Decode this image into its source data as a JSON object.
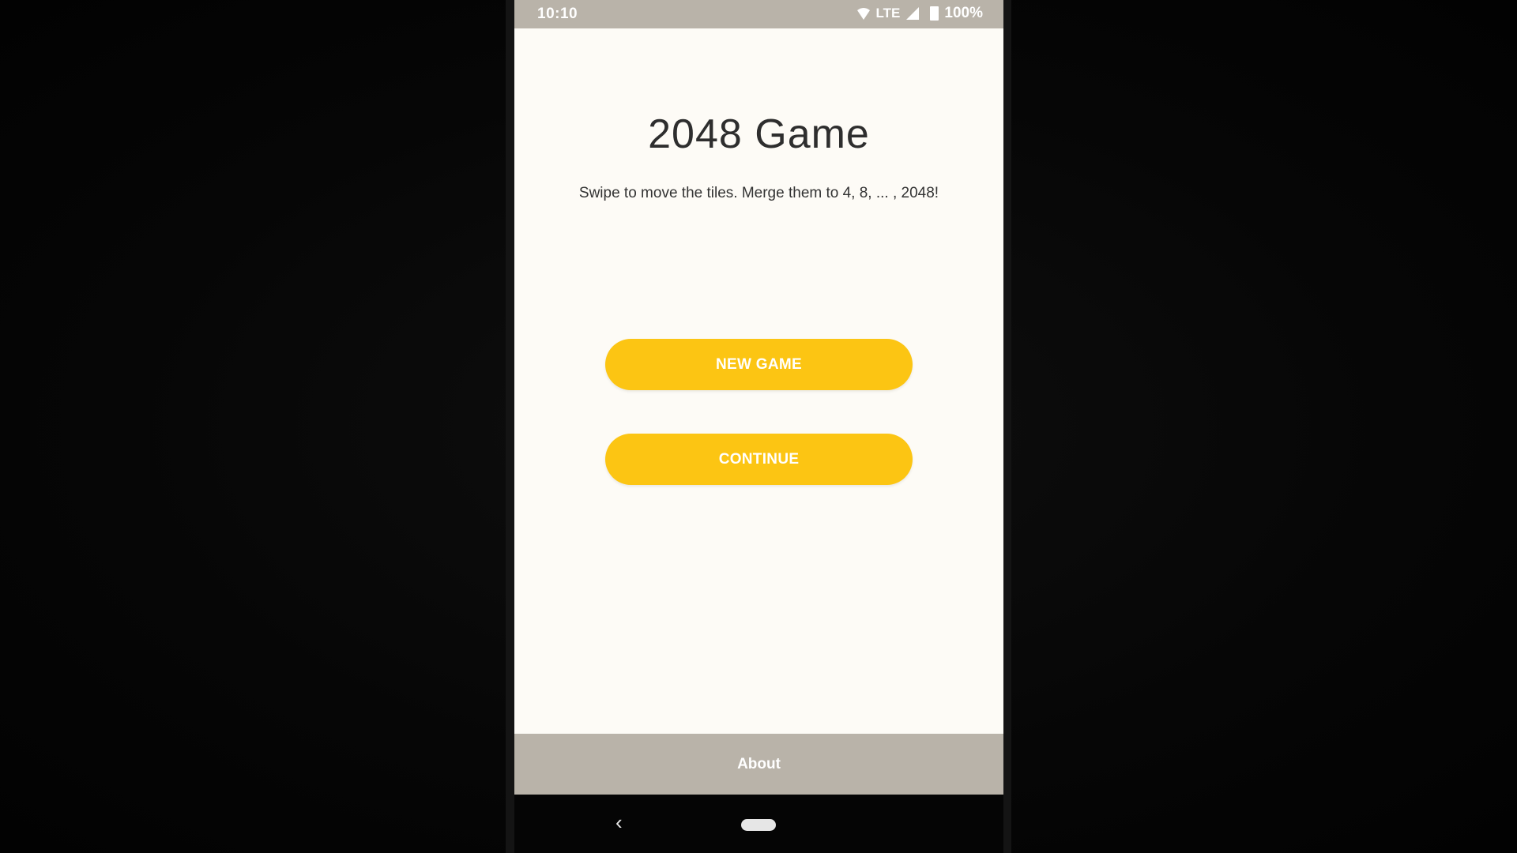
{
  "status_bar": {
    "time": "10:10",
    "network": "LTE",
    "battery": "100%",
    "icons": [
      "wifi-icon",
      "signal-icon",
      "battery-icon"
    ]
  },
  "main": {
    "title": "2048 Game",
    "subtitle": "Swipe to move the tiles. Merge them to 4, 8, ... , 2048!",
    "new_game_label": "NEW GAME",
    "continue_label": "CONTINUE"
  },
  "footer": {
    "about_label": "About"
  },
  "nav": {
    "back_glyph": "‹",
    "icons": [
      "back-icon",
      "home-pill-icon"
    ]
  },
  "colors": {
    "accent": "#fcc513",
    "bar": "#b9b3a9",
    "background": "#fdfbf6",
    "title_text": "#2e2e2e"
  }
}
